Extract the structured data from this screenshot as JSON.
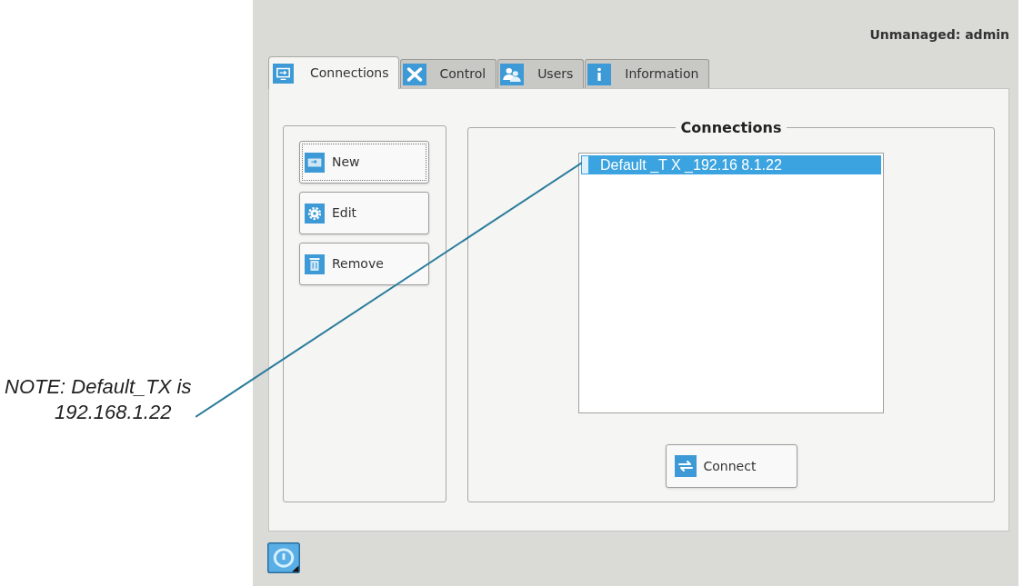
{
  "annotation": {
    "lines": [
      "NOTE: Default_TX is",
      "192.168.1.22"
    ]
  },
  "window": {
    "user_status": "Unmanaged: admin",
    "tabs": [
      {
        "label": "Connections",
        "kind": "connections",
        "selected": true
      },
      {
        "label": "Control",
        "kind": "control",
        "selected": false
      },
      {
        "label": "Users",
        "kind": "users",
        "selected": false
      },
      {
        "label": "Information",
        "kind": "information",
        "selected": false
      }
    ],
    "actions": [
      {
        "label": "New",
        "kind": "new",
        "focused": true
      },
      {
        "label": "Edit",
        "kind": "edit",
        "focused": false
      },
      {
        "label": "Remove",
        "kind": "remove",
        "focused": false
      }
    ],
    "connections_panel": {
      "title": "Connections",
      "items": [
        {
          "label": "Default _T X _192.16 8.1.22",
          "selected": true
        }
      ],
      "connect_button": "Connect"
    }
  }
}
